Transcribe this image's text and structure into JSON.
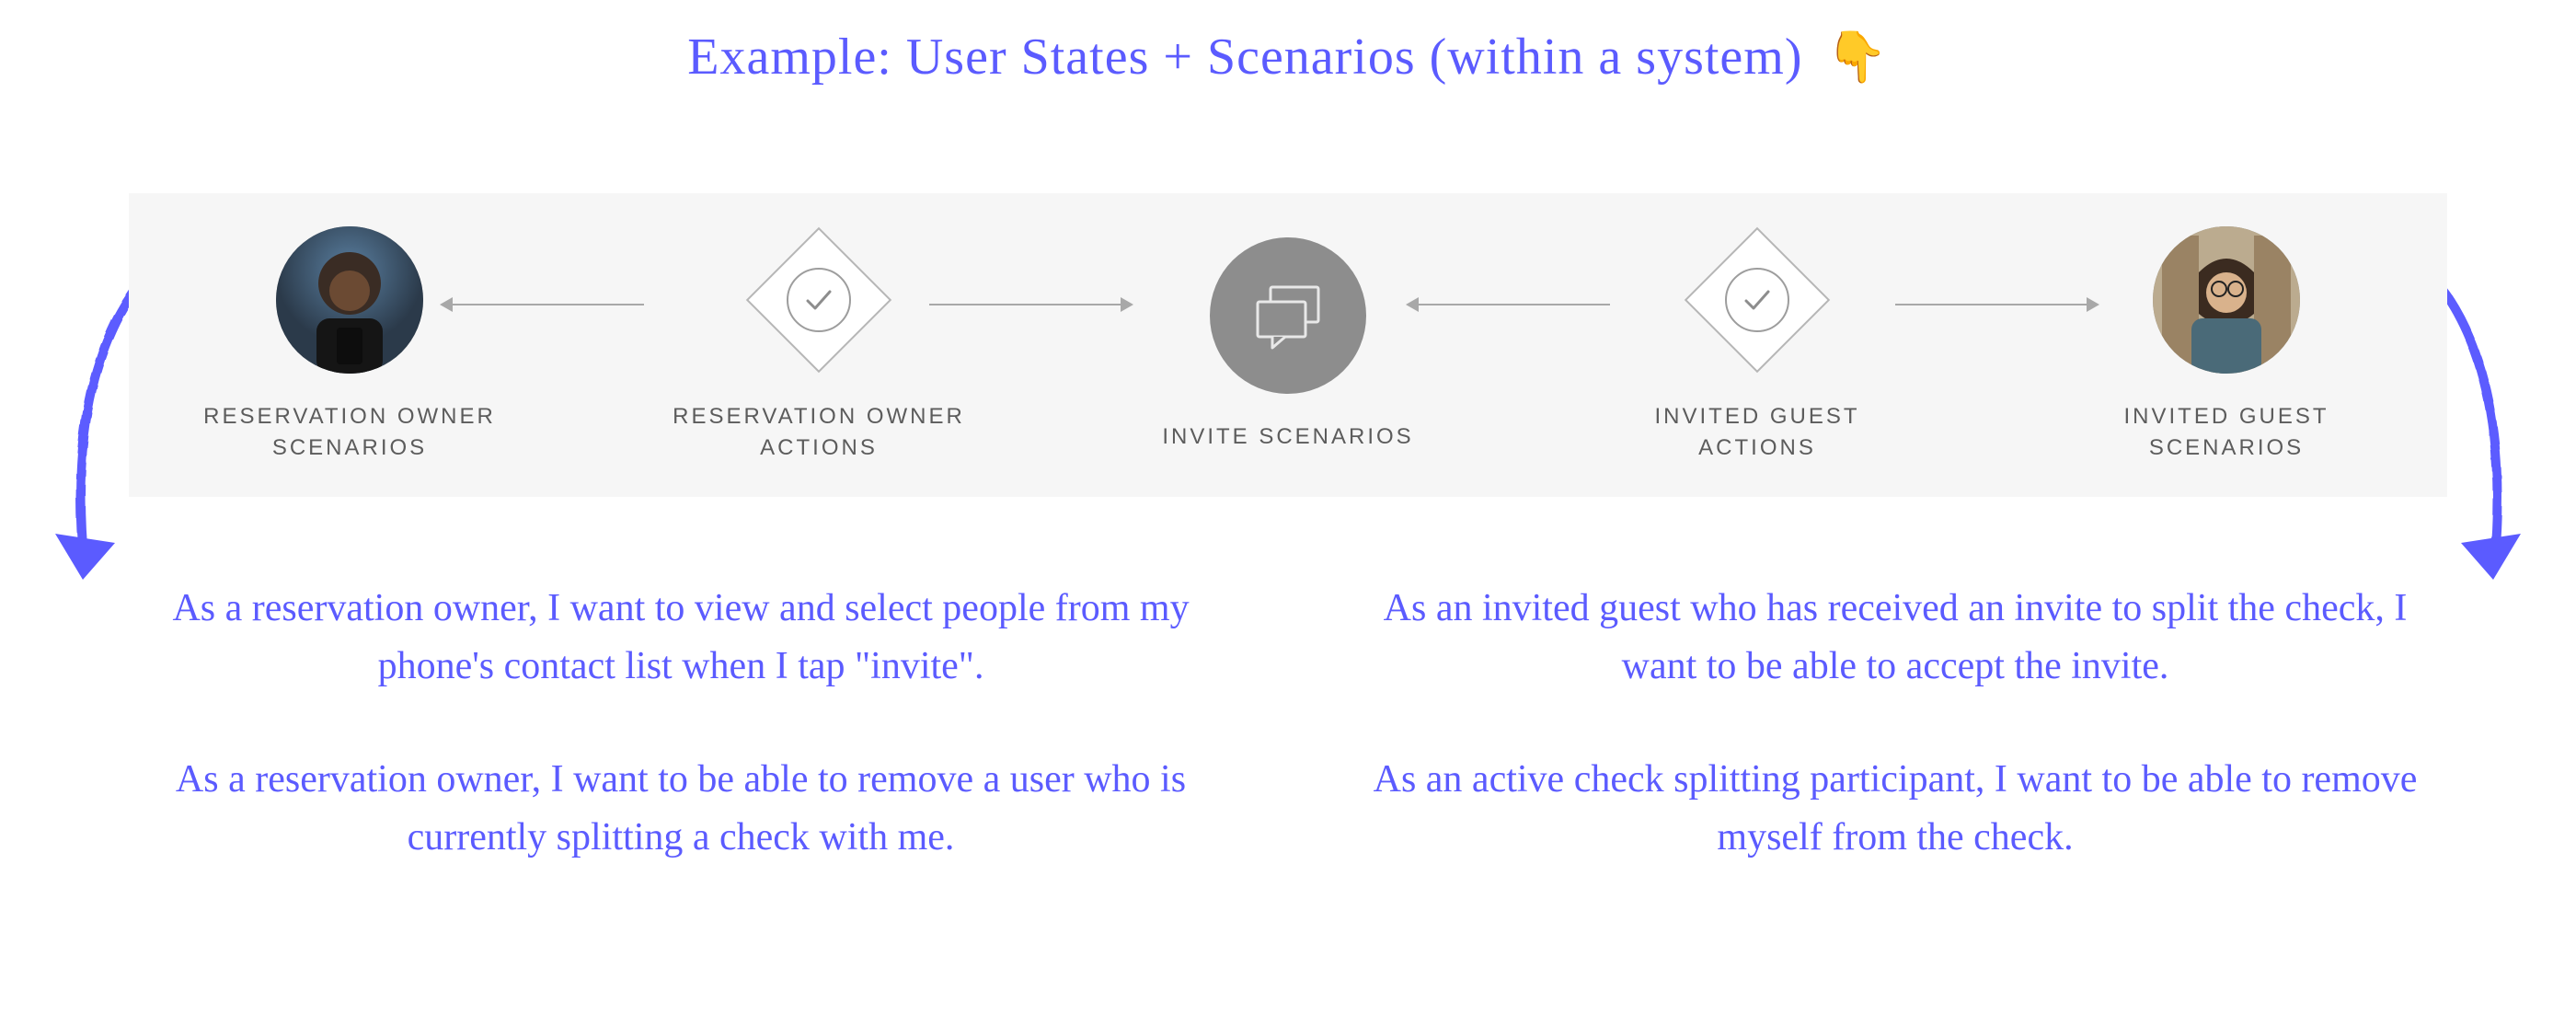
{
  "title": "Example: User States + Scenarios (within a system)",
  "pointer_emoji": "👇",
  "nodes": {
    "reservation_owner_scenarios": "RESERVATION OWNER SCENARIOS",
    "reservation_owner_actions": "RESERVATION OWNER ACTIONS",
    "invite_scenarios": "INVITE SCENARIOS",
    "invited_guest_actions": "INVITED GUEST ACTIONS",
    "invited_guest_scenarios": "INVITED GUEST SCENARIOS"
  },
  "stories_left": [
    "As a reservation owner, I want to view and select people from my phone's contact list when I tap \"invite\".",
    "As a reservation owner, I want to be able to remove a user who is currently splitting a check with me."
  ],
  "stories_right": [
    "As an invited guest who has received an invite to split the check, I want to be able to accept the invite.",
    "As an active check splitting participant, I want to be able to remove myself from the check."
  ],
  "colors": {
    "handwriting": "#5b5bff",
    "band_bg": "#f6f6f6",
    "node_label": "#5c5c5c",
    "line": "#a8a8a8",
    "center_circle": "#8d8d8d"
  }
}
